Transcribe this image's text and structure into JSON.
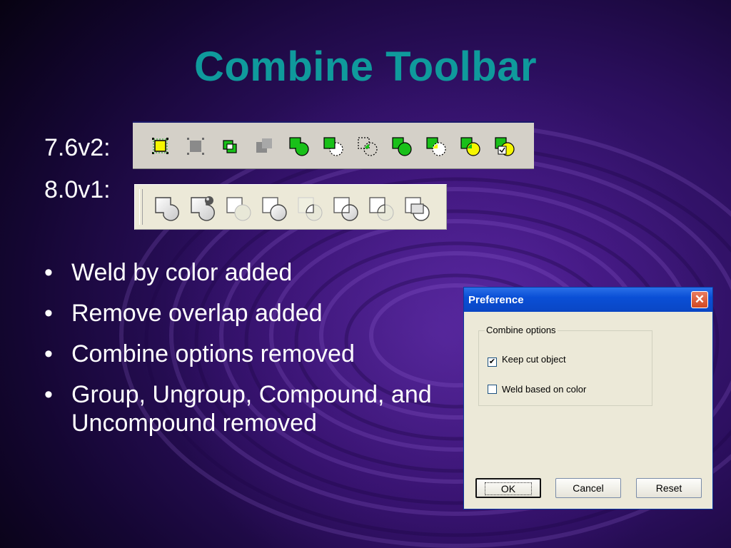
{
  "slide": {
    "title": "Combine Toolbar",
    "version_labels": [
      "7.6v2:",
      "8.0v1:"
    ],
    "bullets": [
      "Weld by color added",
      "Remove overlap added",
      "Combine options removed",
      "Group, Ungroup, Compound, and Uncompound removed"
    ]
  },
  "toolbar_76v2": {
    "buttons": [
      "group",
      "ungroup",
      "compound",
      "uncompound",
      "weld",
      "cut",
      "cut-outline",
      "weld-overlap",
      "weld-dashed",
      "intersect",
      "crop"
    ]
  },
  "toolbar_80v1": {
    "buttons": [
      "weld",
      "weld-by-color",
      "cut",
      "cut-alt",
      "remove-overlap",
      "intersect",
      "intersect-alt",
      "crop"
    ]
  },
  "dialog": {
    "title": "Preference",
    "close_glyph": "✕",
    "group_title": "Combine options",
    "options": [
      {
        "label": "Keep cut object",
        "checked": true
      },
      {
        "label": "Weld based on color",
        "checked": false
      }
    ],
    "buttons": {
      "ok": "OK",
      "cancel": "Cancel",
      "reset": "Reset"
    }
  },
  "colors": {
    "title": "#0f9a9c",
    "text": "#ffffff",
    "green": "#19c019",
    "yellow": "#f6f600",
    "dialog_face": "#ece9d8",
    "titlebar": "#0a4fd6"
  }
}
